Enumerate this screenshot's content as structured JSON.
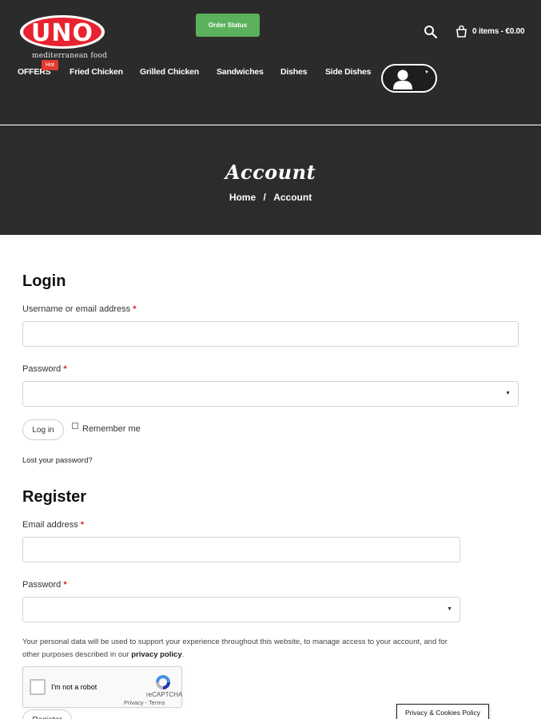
{
  "header": {
    "logo": {
      "text": "UNO",
      "tagline": "mediterranean food"
    },
    "order_status_label": "Order Status",
    "cart": {
      "label": "0 items - €0.00"
    },
    "nav": {
      "items": [
        {
          "label": "OFFERS"
        },
        {
          "label": "Fried Chicken"
        },
        {
          "label": "Grilled Chicken"
        },
        {
          "label": "Sandwiches"
        },
        {
          "label": "Dishes"
        },
        {
          "label": "Side Dishes"
        }
      ],
      "hot_badge": "Hot"
    },
    "icons": {
      "search": "search-icon",
      "cart": "cart-icon",
      "user": "user-icon"
    }
  },
  "banner": {
    "title": "Account",
    "breadcrumb": {
      "home": "Home",
      "separator": "/",
      "current": "Account"
    }
  },
  "login": {
    "heading": "Login",
    "username_label": "Username or email address",
    "password_label": "Password",
    "required_mark": "*",
    "login_button": "Log in",
    "remember_label": "Remember me",
    "lost_password": "Lost your password?"
  },
  "register": {
    "heading": "Register",
    "email_label": "Email address",
    "password_label": "Password",
    "required_mark": "*",
    "privacy_text_before": "Your personal data will be used to support your experience throughout this website, to manage access to your account, and for other purposes described in our ",
    "privacy_link": "privacy policy",
    "privacy_text_after": ".",
    "register_button": "Register"
  },
  "recaptcha": {
    "label": "I'm not a robot",
    "brand": "reCAPTCHA",
    "links": "Privacy - Terms"
  },
  "cookie_button": "Privacy & Cookies Policy",
  "colors": {
    "header_bg": "#2b2b2b",
    "accent_red": "#e03a2e",
    "order_status_green": "#5cb15c",
    "required_red": "#d6282b"
  }
}
